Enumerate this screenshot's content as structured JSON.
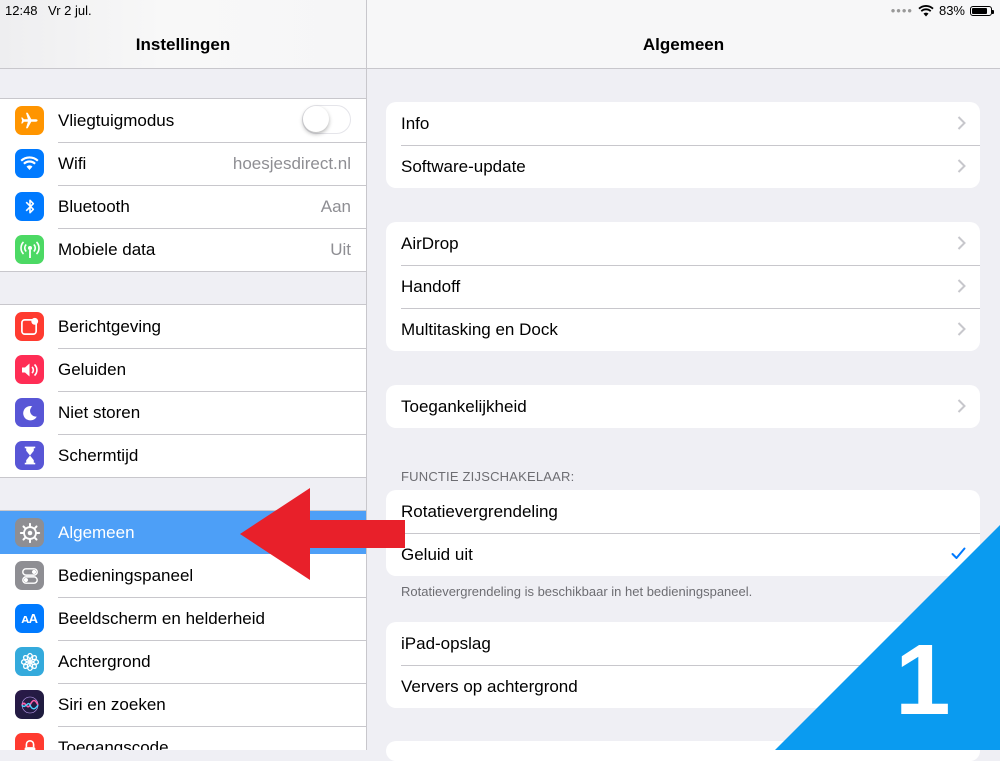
{
  "status_bar": {
    "time": "12:48",
    "date": "Vr 2 jul.",
    "battery": "83%",
    "battery_level": 0.83
  },
  "sidebar": {
    "title": "Instellingen",
    "groups": [
      [
        {
          "label": "Vliegtuigmodus",
          "icon": "airplane-icon",
          "color": "#ff9500",
          "toggle": false
        },
        {
          "label": "Wifi",
          "icon": "wifi-icon",
          "color": "#007aff",
          "value": "hoesjesdirect.nl"
        },
        {
          "label": "Bluetooth",
          "icon": "bluetooth-icon",
          "color": "#007aff",
          "value": "Aan"
        },
        {
          "label": "Mobiele data",
          "icon": "cellular-icon",
          "color": "#4cd964",
          "value": "Uit"
        }
      ],
      [
        {
          "label": "Berichtgeving",
          "icon": "notifications-icon",
          "color": "#ff3b30"
        },
        {
          "label": "Geluiden",
          "icon": "sounds-icon",
          "color": "#ff2d55"
        },
        {
          "label": "Niet storen",
          "icon": "moon-icon",
          "color": "#5856d6"
        },
        {
          "label": "Schermtijd",
          "icon": "hourglass-icon",
          "color": "#5856d6"
        }
      ],
      [
        {
          "label": "Algemeen",
          "icon": "gear-icon",
          "color": "#8e8e93",
          "selected": true
        },
        {
          "label": "Bedieningspaneel",
          "icon": "control-center-icon",
          "color": "#8e8e93"
        },
        {
          "label": "Beeldscherm en helderheid",
          "icon": "display-icon",
          "color": "#007aff"
        },
        {
          "label": "Achtergrond",
          "icon": "wallpaper-icon",
          "color": "#34aadc"
        },
        {
          "label": "Siri en zoeken",
          "icon": "siri-icon",
          "color": "#1c1c3c"
        },
        {
          "label": "Toegangscode",
          "icon": "lock-icon",
          "color": "#ff3b30"
        }
      ]
    ]
  },
  "detail": {
    "title": "Algemeen",
    "groups": [
      {
        "rows": [
          {
            "label": "Info"
          },
          {
            "label": "Software-update"
          }
        ]
      },
      {
        "rows": [
          {
            "label": "AirDrop"
          },
          {
            "label": "Handoff"
          },
          {
            "label": "Multitasking en Dock"
          }
        ]
      },
      {
        "rows": [
          {
            "label": "Toegankelijkheid"
          }
        ]
      },
      {
        "rows": [
          {
            "label": "Rotatievergrendeling"
          },
          {
            "label": "Geluid uit",
            "checked": true
          }
        ]
      },
      {
        "rows": [
          {
            "label": "iPad-opslag"
          },
          {
            "label": "Ververs op achtergrond"
          }
        ]
      }
    ],
    "section_header": "FUNCTIE ZIJSCHAKELAAR:",
    "section_footer": "Rotatievergrendeling is beschikbaar in het bedieningspaneel."
  },
  "overlay": {
    "step_number": "1",
    "arrow_color": "#e8202a",
    "badge_color": "#0a9bf0"
  }
}
